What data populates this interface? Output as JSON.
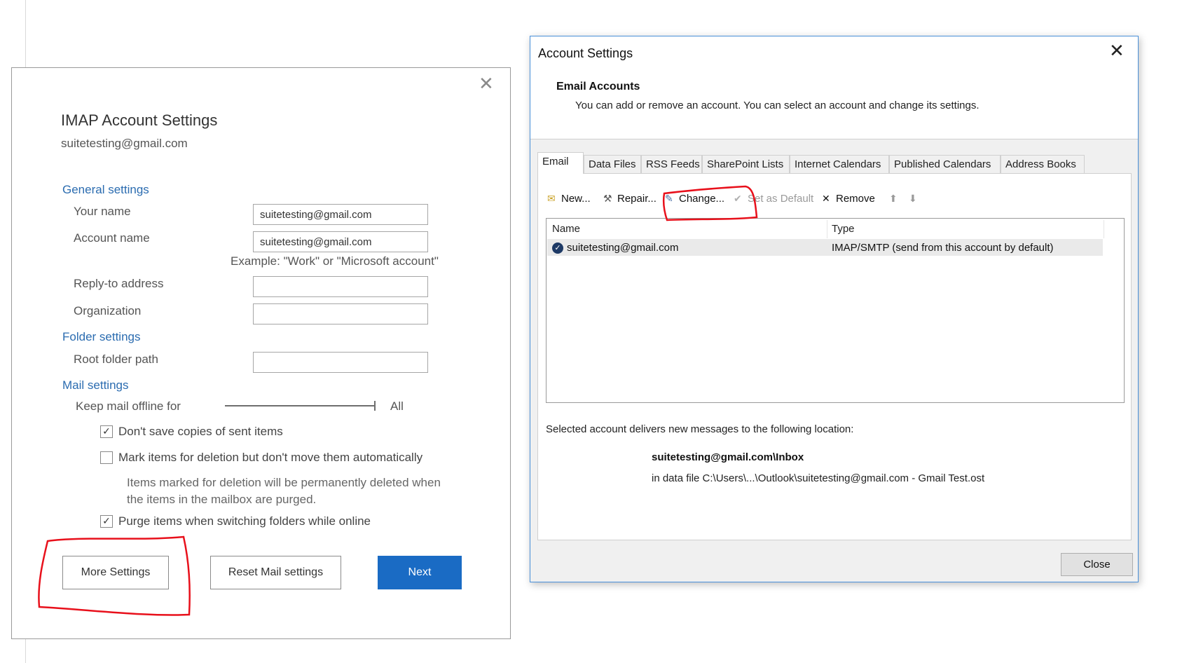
{
  "imap": {
    "title": "IMAP Account Settings",
    "email": "suitetesting@gmail.com",
    "general_header": "General settings",
    "your_name_label": "Your name",
    "your_name_value": "suitetesting@gmail.com",
    "account_name_label": "Account name",
    "account_name_value": "suitetesting@gmail.com",
    "account_name_example": "Example: \"Work\" or \"Microsoft account\"",
    "reply_to_label": "Reply-to address",
    "reply_to_value": "",
    "organization_label": "Organization",
    "organization_value": "",
    "folder_header": "Folder settings",
    "root_folder_label": "Root folder path",
    "root_folder_value": "",
    "mail_header": "Mail settings",
    "keep_offline_label": "Keep mail offline for",
    "keep_offline_value": "All",
    "checkboxes": [
      {
        "label": "Don't save copies of sent items",
        "checked": true
      },
      {
        "label": "Mark items for deletion but don't move them automatically",
        "checked": false
      },
      {
        "label": "Purge items when switching folders while online",
        "checked": true
      }
    ],
    "deletion_note": "Items marked for deletion will be permanently deleted when the items in the mailbox are purged.",
    "more_settings_btn": "More Settings",
    "reset_btn": "Reset Mail settings",
    "next_btn": "Next",
    "close_glyph": "✕"
  },
  "account_settings": {
    "window_title": "Account Settings",
    "close_glyph": "✕",
    "heading": "Email Accounts",
    "description": "You can add or remove an account. You can select an account and change its settings.",
    "tabs": [
      "Email",
      "Data Files",
      "RSS Feeds",
      "SharePoint Lists",
      "Internet Calendars",
      "Published Calendars",
      "Address Books"
    ],
    "active_tab": "Email",
    "toolbar": {
      "new": "New...",
      "repair": "Repair...",
      "change": "Change...",
      "set_default": "Set as Default",
      "remove": "Remove"
    },
    "columns": {
      "name": "Name",
      "type": "Type"
    },
    "accounts": [
      {
        "name": "suitetesting@gmail.com",
        "type": "IMAP/SMTP (send from this account by default)"
      }
    ],
    "delivery_text": "Selected account delivers new messages to the following location:",
    "delivery_folder": "suitetesting@gmail.com\\Inbox",
    "data_file": "in data file C:\\Users\\...\\Outlook\\suitetesting@gmail.com - Gmail Test.ost",
    "close_btn": "Close"
  },
  "colors": {
    "primary_button": "#1a6bc4",
    "section_header": "#2b6cb0",
    "annotation": "#e8101b",
    "window_border": "#4a90d9"
  },
  "icons": [
    "close-icon",
    "new-account-icon",
    "repair-icon",
    "change-icon",
    "set-default-icon",
    "remove-icon",
    "move-up-icon",
    "move-down-icon",
    "default-account-check-icon",
    "checkbox-check-icon"
  ]
}
